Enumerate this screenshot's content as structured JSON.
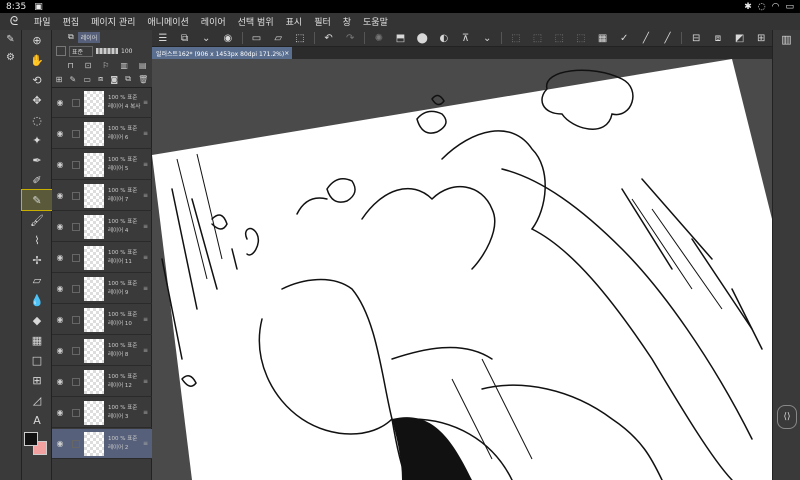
{
  "status": {
    "time": "8:35",
    "icons": [
      "bluetooth-icon",
      "mute-icon",
      "wifi-icon",
      "battery-icon"
    ]
  },
  "menu": [
    "파일",
    "편집",
    "페이지 관리",
    "애니메이션",
    "레이어",
    "선택 범위",
    "표시",
    "필터",
    "창",
    "도움말"
  ],
  "document_tab": {
    "title": "일러스트162* (906 x 1453px 80dpi 171.2%)",
    "close": "×"
  },
  "layers_panel": {
    "folder_label": "레이어",
    "blend_mode": "표준",
    "opacity": "100"
  },
  "layers": [
    {
      "line1": "100 % 표준",
      "line2": "레이어 4 복사"
    },
    {
      "line1": "100 % 표준",
      "line2": "레이어 6"
    },
    {
      "line1": "100 % 표준",
      "line2": "레이어 5"
    },
    {
      "line1": "100 % 표준",
      "line2": "레이어 7"
    },
    {
      "line1": "100 % 표준",
      "line2": "레이어 4"
    },
    {
      "line1": "100 % 표준",
      "line2": "레이어 11"
    },
    {
      "line1": "100 % 표준",
      "line2": "레이어 9"
    },
    {
      "line1": "100 % 표준",
      "line2": "레이어 10"
    },
    {
      "line1": "100 % 표준",
      "line2": "레이어 8"
    },
    {
      "line1": "100 % 표준",
      "line2": "레이어 12"
    },
    {
      "line1": "100 % 표준",
      "line2": "레이어 3"
    },
    {
      "line1": "100 % 표준",
      "line2": "레이어 2"
    }
  ],
  "colors": {
    "main": "#111111",
    "sub": "#f2a0a0",
    "accent": "#c9b000",
    "selected_layer": "#56607a"
  }
}
